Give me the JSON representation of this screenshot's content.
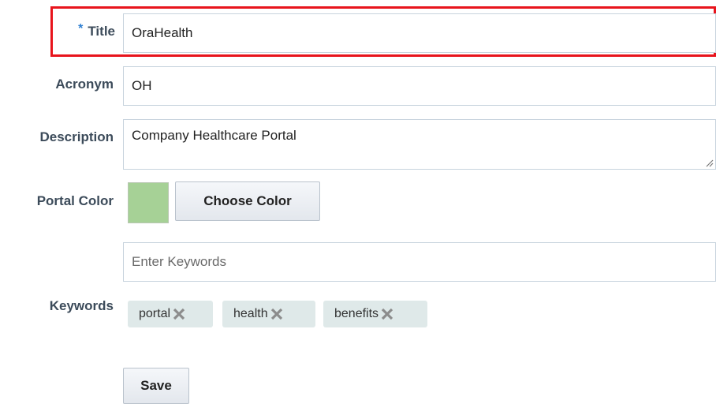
{
  "form": {
    "title": {
      "label": "Title",
      "required_marker": "*",
      "value": "OraHealth"
    },
    "acronym": {
      "label": "Acronym",
      "value": "OH"
    },
    "description": {
      "label": "Description",
      "value": "Company Healthcare Portal"
    },
    "portal_color": {
      "label": "Portal Color",
      "swatch_color": "#a6d196",
      "button_label": "Choose Color"
    },
    "keywords": {
      "label": "Keywords",
      "placeholder": "Enter Keywords",
      "chips": [
        {
          "label": "portal",
          "remove_icon": "close-icon"
        },
        {
          "label": "health",
          "remove_icon": "close-icon"
        },
        {
          "label": "benefits",
          "remove_icon": "close-icon"
        }
      ]
    },
    "save_label": "Save"
  },
  "colors": {
    "highlight_border": "#e8141c",
    "label_text": "#3c4b5a",
    "required_star": "#2f7fd2",
    "chip_background": "#dfe9e9",
    "input_border": "#c7d3dd"
  }
}
